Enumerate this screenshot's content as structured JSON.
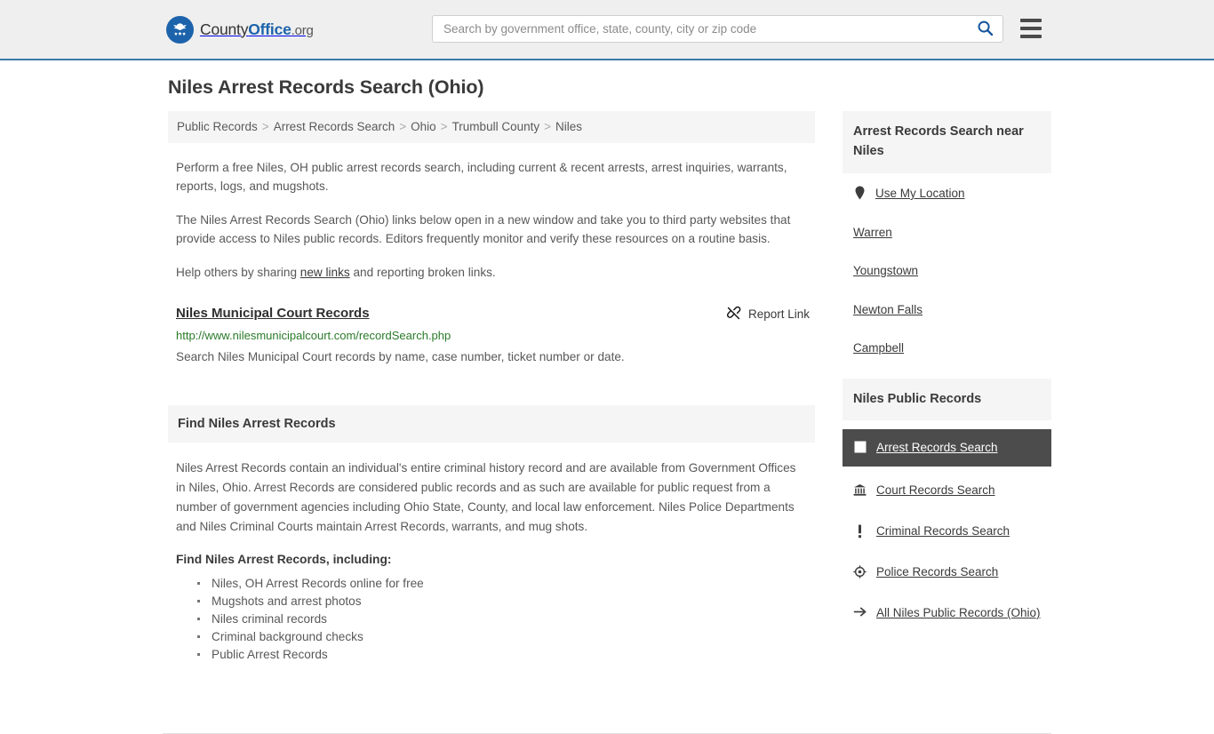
{
  "header": {
    "brand": {
      "part1": "County",
      "part2": "Office",
      "part3": ".org",
      "logo_icon": "eagle-seal-icon"
    },
    "search": {
      "placeholder": "Search by government office, state, county, city or zip code",
      "value": "",
      "icon": "search-icon"
    },
    "menu_icon": "hamburger-menu-icon"
  },
  "page": {
    "title": "Niles Arrest Records Search (Ohio)",
    "breadcrumb": [
      "Public Records",
      "Arrest Records Search",
      "Ohio",
      "Trumbull County",
      "Niles"
    ],
    "breadcrumb_separator": ">",
    "intro": [
      "Perform a free Niles, OH public arrest records search, including current & recent arrests, arrest inquiries, warrants, reports, logs, and mugshots.",
      "The Niles Arrest Records Search (Ohio) links below open in a new window and take you to third party websites that provide access to Niles public records. Editors frequently monitor and verify these resources on a routine basis."
    ],
    "help_prefix": "Help others by sharing ",
    "help_link": "new links",
    "help_suffix": " and reporting broken links."
  },
  "result": {
    "title": "Niles Municipal Court Records",
    "url": "http://www.nilesmunicipalcourt.com/recordSearch.php",
    "description": "Search Niles Municipal Court records by name, case number, ticket number or date.",
    "report_label": "Report Link",
    "report_icon": "broken-link-icon"
  },
  "section": {
    "heading": "Find Niles Arrest Records",
    "paragraph": "Niles Arrest Records contain an individual's entire criminal history record and are available from Government Offices in Niles, Ohio. Arrest Records are considered public records and as such are available for public request from a number of government agencies including Ohio State, County, and local law enforcement. Niles Police Departments and Niles Criminal Courts maintain Arrest Records, warrants, and mug shots.",
    "subheading": "Find Niles Arrest Records, including:",
    "bullets": [
      "Niles, OH Arrest Records online for free",
      "Mugshots and arrest photos",
      "Niles criminal records",
      "Criminal background checks",
      "Public Arrest Records"
    ]
  },
  "sidebar": {
    "near_panel": {
      "heading": "Arrest Records Search near Niles",
      "items": [
        {
          "label": "Use My Location",
          "icon": "map-pin-icon"
        },
        {
          "label": "Warren",
          "icon": ""
        },
        {
          "label": "Youngstown",
          "icon": ""
        },
        {
          "label": "Newton Falls",
          "icon": ""
        },
        {
          "label": "Campbell",
          "icon": ""
        }
      ]
    },
    "records_panel": {
      "heading": "Niles Public Records",
      "items": [
        {
          "label": "Arrest Records Search",
          "icon": "document-icon",
          "active": true
        },
        {
          "label": "Court Records Search",
          "icon": "courthouse-icon",
          "active": false
        },
        {
          "label": "Criminal Records Search",
          "icon": "exclamation-icon",
          "active": false
        },
        {
          "label": "Police Records Search",
          "icon": "police-badge-icon",
          "active": false
        },
        {
          "label": "All Niles Public Records (Ohio)",
          "icon": "arrow-right-icon",
          "active": false
        }
      ]
    }
  },
  "colors": {
    "brand_blue": "#1c63ab",
    "header_bg": "#efefef",
    "header_rule": "#3b7aa8",
    "panel_bg": "#f5f5f5",
    "active_bg": "#4c4c4c",
    "url_green": "#2a7b2a",
    "body_text": "#585858"
  }
}
